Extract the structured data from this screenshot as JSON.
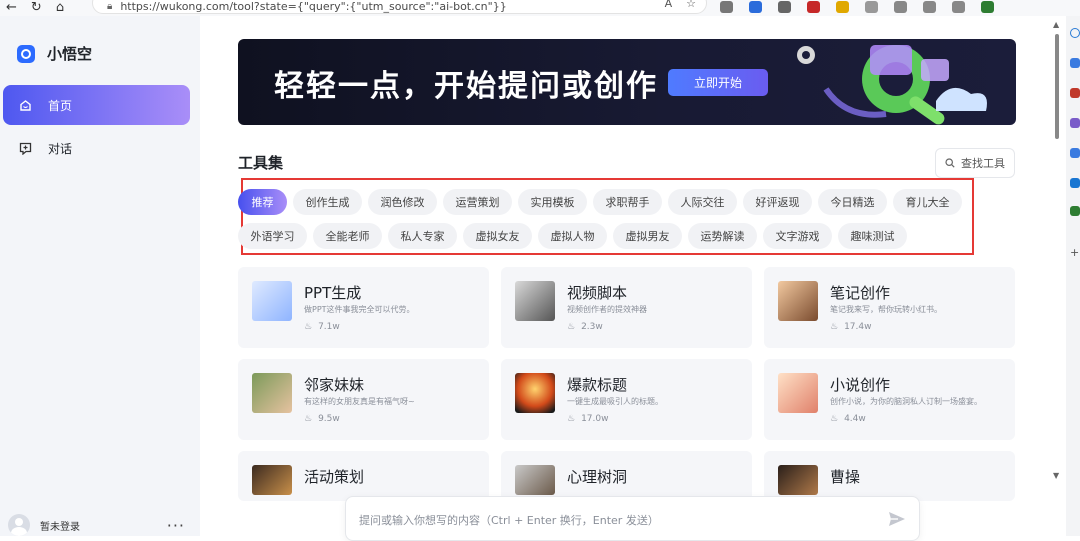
{
  "browser": {
    "url": "https://wukong.com/tool?state={\"query\":{\"utm_source\":\"ai-bot.cn\"}}",
    "nav_icons": [
      "back-icon",
      "refresh-icon",
      "home-icon"
    ]
  },
  "sidebar": {
    "app_name": "小悟空",
    "items": [
      {
        "label": "首页",
        "icon": "home-icon",
        "active": true
      },
      {
        "label": "对话",
        "icon": "chat-icon",
        "active": false
      }
    ],
    "user": {
      "name": "暂未登录",
      "more": "···"
    }
  },
  "banner": {
    "title": "轻轻一点，开始提问或创作",
    "button": "立即开始"
  },
  "tools": {
    "section_title": "工具集",
    "search_label": "查找工具",
    "categories_row1": [
      "推荐",
      "创作生成",
      "润色修改",
      "运营策划",
      "实用模板",
      "求职帮手",
      "人际交往",
      "好评返现",
      "今日精选",
      "育儿大全"
    ],
    "categories_row2": [
      "外语学习",
      "全能老师",
      "私人专家",
      "虚拟女友",
      "虚拟人物",
      "虚拟男友",
      "运势解读",
      "文字游戏",
      "趣味测试"
    ],
    "active_category": "推荐"
  },
  "cards": [
    {
      "title": "PPT生成",
      "desc": "做PPT这件事我完全可以代劳。",
      "count": "7.1w"
    },
    {
      "title": "视频脚本",
      "desc": "视频创作者的提效神器",
      "count": "2.3w"
    },
    {
      "title": "笔记创作",
      "desc": "笔记我来写，帮你玩转小红书。",
      "count": "17.4w"
    },
    {
      "title": "邻家妹妹",
      "desc": "有这样的女朋友真是有福气呀~",
      "count": "9.5w"
    },
    {
      "title": "爆款标题",
      "desc": "一键生成最吸引人的标题。",
      "count": "17.0w"
    },
    {
      "title": "小说创作",
      "desc": "创作小说，为你的脑洞私人订制一场盛宴。",
      "count": "4.4w"
    },
    {
      "title": "活动策划",
      "desc": "",
      "count": ""
    },
    {
      "title": "心理树洞",
      "desc": "",
      "count": ""
    },
    {
      "title": "曹操",
      "desc": "",
      "count": ""
    }
  ],
  "composer": {
    "placeholder": "提问或输入你想写的内容（Ctrl + Enter 换行，Enter 发送）"
  },
  "colors": {
    "accent": "#4e58f0",
    "accent_end": "#a98ef8",
    "highlight_border": "#e53935"
  }
}
